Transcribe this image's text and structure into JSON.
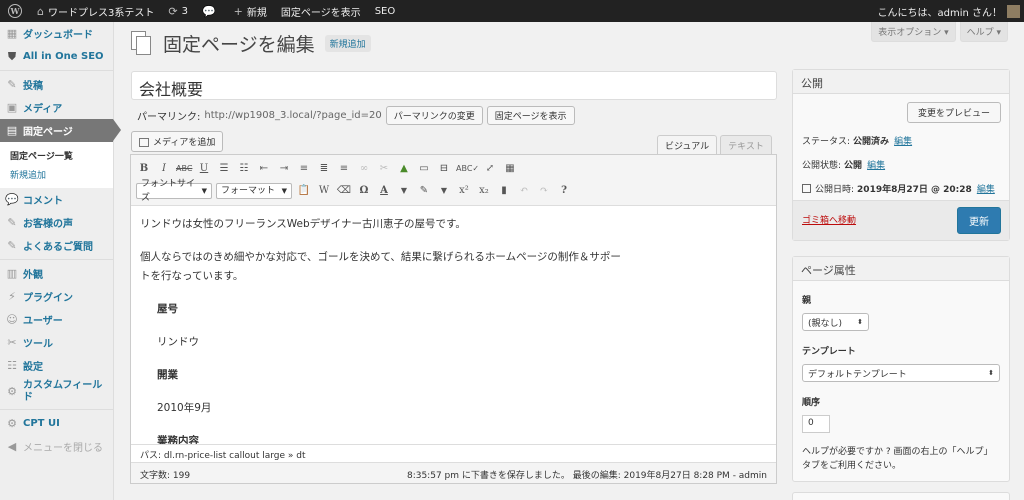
{
  "adminbar": {
    "site_name": "ワードプレス3系テスト",
    "updates_count": "3",
    "new_label": "新規",
    "view_page": "固定ページを表示",
    "seo": "SEO",
    "greeting": "こんにちは、admin さん！"
  },
  "sidebar": {
    "items": [
      {
        "label": "ダッシュボード",
        "icon": "dashboard-icon"
      },
      {
        "label": "All in One SEO",
        "icon": "shield-icon"
      },
      {
        "label": "投稿",
        "icon": "pin-icon"
      },
      {
        "label": "メディア",
        "icon": "media-icon"
      },
      {
        "label": "固定ページ",
        "icon": "pages-icon"
      },
      {
        "label": "コメント",
        "icon": "comment-icon"
      },
      {
        "label": "お客様の声",
        "icon": "pin-icon"
      },
      {
        "label": "よくあるご質問",
        "icon": "pin-icon"
      },
      {
        "label": "外観",
        "icon": "appearance-icon"
      },
      {
        "label": "プラグイン",
        "icon": "plugin-icon"
      },
      {
        "label": "ユーザー",
        "icon": "users-icon"
      },
      {
        "label": "ツール",
        "icon": "tools-icon"
      },
      {
        "label": "設定",
        "icon": "settings-icon"
      },
      {
        "label": "カスタムフィールド",
        "icon": "gear-icon"
      },
      {
        "label": "CPT UI",
        "icon": "gear-icon"
      },
      {
        "label": "メニューを閉じる",
        "icon": "collapse-icon"
      }
    ],
    "submenu": [
      "固定ページ一覧",
      "新規追加"
    ]
  },
  "screen_options": "表示オプション ▾",
  "help": "ヘルプ ▾",
  "page": {
    "title": "固定ページを編集",
    "add_new": "新規追加",
    "post_title": "会社概要",
    "permalink_label": "パーマリンク:",
    "permalink_url": "http://wp1908_3.local/?page_id=20",
    "change_permalink": "パーマリンクの変更",
    "view_page": "固定ページを表示",
    "add_media": "メディアを追加",
    "tab_visual": "ビジュアル",
    "tab_text": "テキスト"
  },
  "toolbar": {
    "font_size": "フォントサイズ",
    "format": "フォーマット"
  },
  "content": {
    "p1": "リンドウは女性のフリーランスWebデザイナー古川恵子の屋号です。",
    "p2": "個人ならではのきめ細やかな対応で、ゴールを決めて、結果に繋げられるホームページの制作＆サポートを行なっています。",
    "dt1": "屋号",
    "dd1": "リンドウ",
    "dt2": "開業",
    "dd2": "2010年9月",
    "dt3": "業務内容"
  },
  "path": "パス: dl.rn-price-list callout large » dt",
  "word_count": "文字数: 199",
  "autosave": "8:35:57 pm に下書きを保存しました。 最後の編集: 2019年8月27日 8:28 PM - admin",
  "publish": {
    "header": "公開",
    "preview": "変更をプレビュー",
    "status_label": "ステータス:",
    "status_value": "公開済み",
    "visibility_label": "公開状態:",
    "visibility_value": "公開",
    "date_label": "公開日時:",
    "date_value": "2019年8月27日 @ 20:28",
    "edit": "編集",
    "trash": "ゴミ箱へ移動",
    "update": "更新"
  },
  "attributes": {
    "header": "ページ属性",
    "parent_label": "親",
    "parent_value": "(親なし)",
    "template_label": "テンプレート",
    "template_value": "デフォルトテンプレート",
    "order_label": "順序",
    "order_value": "0",
    "help": "ヘルプが必要ですか ? 画面の右上の「ヘルプ」タブをご利用ください。"
  }
}
